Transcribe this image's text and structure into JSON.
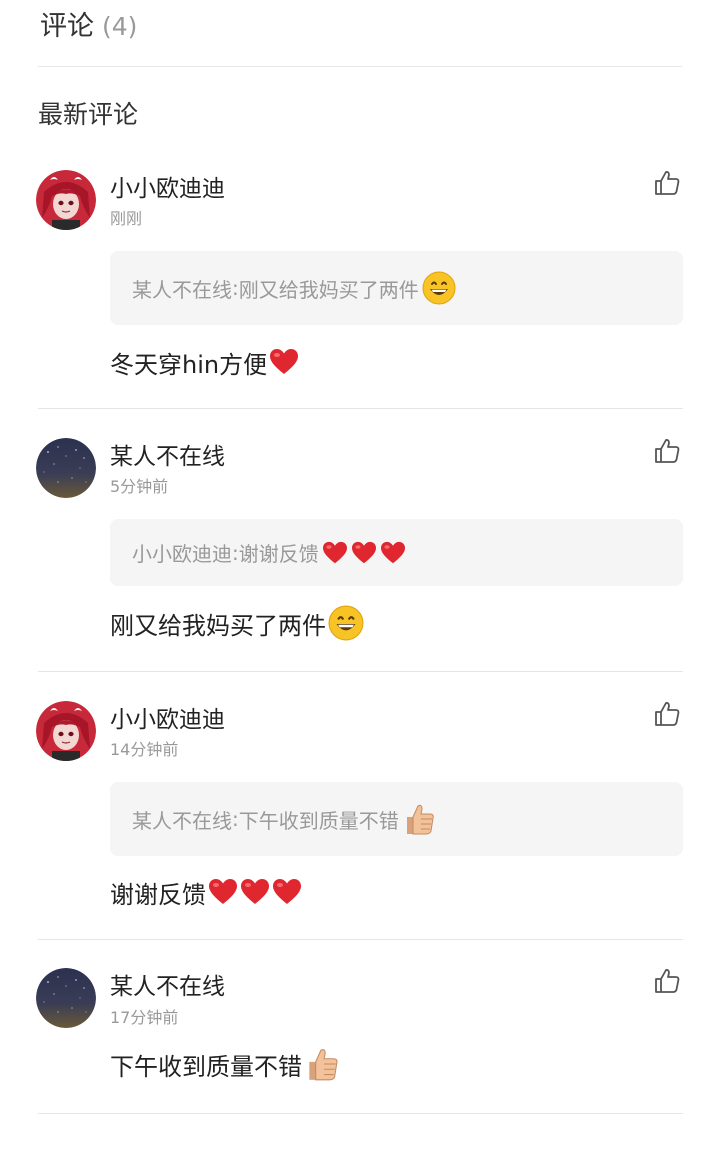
{
  "header": {
    "title": "评论",
    "count": "(4)"
  },
  "section_title": "最新评论",
  "comments": [
    {
      "username": "小小欧迪迪",
      "time": "刚刚",
      "avatar": "anime-avatar",
      "reply": {
        "author": "某人不在线",
        "separator": ": ",
        "text": "刚又给我妈买了两件",
        "emoji": "grinning-face-icon"
      },
      "body": {
        "text": "冬天穿hin方便",
        "emoji": "red-heart-icon",
        "emoji_count": 1
      }
    },
    {
      "username": "某人不在线",
      "time": "5分钟前",
      "avatar": "night-sky-avatar",
      "reply": {
        "author": "小小欧迪迪",
        "separator": ": ",
        "text": "谢谢反馈",
        "emoji": "red-heart-icon",
        "emoji_count": 3
      },
      "body": {
        "text": "刚又给我妈买了两件",
        "emoji": "grinning-face-icon",
        "emoji_count": 1
      }
    },
    {
      "username": "小小欧迪迪",
      "time": "14分钟前",
      "avatar": "anime-avatar",
      "reply": {
        "author": "某人不在线",
        "separator": ": ",
        "text": "下午收到质量不错",
        "emoji": "thumbs-up-icon"
      },
      "body": {
        "text": "谢谢反馈",
        "emoji": "red-heart-icon",
        "emoji_count": 3
      }
    },
    {
      "username": "某人不在线",
      "time": "17分钟前",
      "avatar": "night-sky-avatar",
      "body": {
        "text": "下午收到质量不错",
        "emoji": "thumbs-up-icon",
        "emoji_count": 1
      }
    }
  ],
  "colors": {
    "text_primary": "#222222",
    "text_secondary": "#999999",
    "reply_background": "#f5f5f5",
    "divider": "#e6e6e6",
    "heart": "#e0262e",
    "emoji_face": "#f7c325"
  }
}
